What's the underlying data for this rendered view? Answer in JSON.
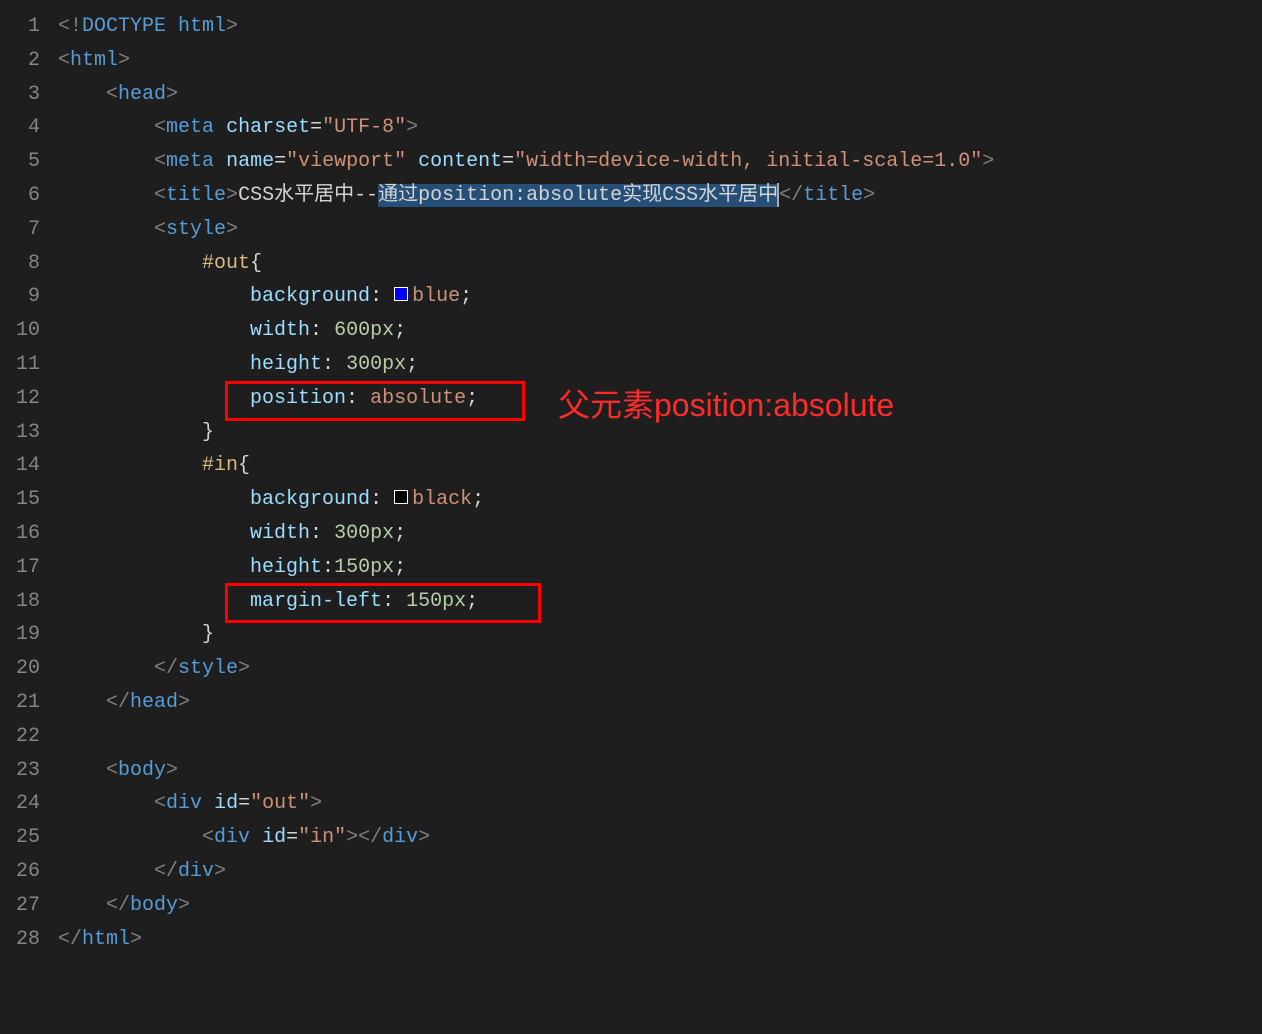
{
  "lines": {
    "l1": {
      "doctype": "DOCTYPE html"
    },
    "l2": {
      "tag": "html"
    },
    "l3": {
      "tag": "head"
    },
    "l4": {
      "tag": "meta",
      "attr1": "charset",
      "val1": "\"UTF-8\""
    },
    "l5": {
      "tag": "meta",
      "attr1": "name",
      "val1": "\"viewport\"",
      "attr2": "content",
      "val2": "\"width=device-width, initial-scale=1.0\""
    },
    "l6": {
      "tag": "title",
      "text_pre": "CSS水平居中--",
      "text_sel": "通过position:absolute实现CSS水平居中",
      "closetag": "title"
    },
    "l7": {
      "tag": "style"
    },
    "l8": {
      "sel": "#out",
      "brace": "{"
    },
    "l9": {
      "prop": "background",
      "colon": ":",
      "color": "blue",
      "val": "blue",
      "semi": ";"
    },
    "l10": {
      "prop": "width",
      "colon": ":",
      "val": " 600px",
      "semi": ";"
    },
    "l11": {
      "prop": "height",
      "colon": ":",
      "val": " 300px",
      "semi": ";"
    },
    "l12": {
      "prop": "position",
      "colon": ":",
      "val": " absolute",
      "semi": ";"
    },
    "l13": {
      "brace": "}"
    },
    "l14": {
      "sel": "#in",
      "brace": "{"
    },
    "l15": {
      "prop": "background",
      "colon": ":",
      "color": "black",
      "val": "black",
      "semi": ";"
    },
    "l16": {
      "prop": "width",
      "colon": ":",
      "val": " 300px",
      "semi": ";"
    },
    "l17": {
      "prop": "height",
      "colon": ":",
      "val": "150px",
      "semi": ";"
    },
    "l18": {
      "prop": "margin-left",
      "colon": ":",
      "val": " 150px",
      "semi": ";"
    },
    "l19": {
      "brace": "}"
    },
    "l20": {
      "closetag": "style"
    },
    "l21": {
      "closetag": "head"
    },
    "l23": {
      "tag": "body"
    },
    "l24": {
      "tag": "div",
      "attr1": "id",
      "val1": "\"out\""
    },
    "l25": {
      "tag": "div",
      "attr1": "id",
      "val1": "\"in\"",
      "closetag": "div"
    },
    "l26": {
      "closetag": "div"
    },
    "l27": {
      "closetag": "body"
    },
    "l28": {
      "closetag": "html"
    }
  },
  "annotation": {
    "text": "父元素position:absolute"
  },
  "line_numbers": [
    "1",
    "2",
    "3",
    "4",
    "5",
    "6",
    "7",
    "8",
    "9",
    "10",
    "11",
    "12",
    "13",
    "14",
    "15",
    "16",
    "17",
    "18",
    "19",
    "20",
    "21",
    "22",
    "23",
    "24",
    "25",
    "26",
    "27",
    "28"
  ]
}
